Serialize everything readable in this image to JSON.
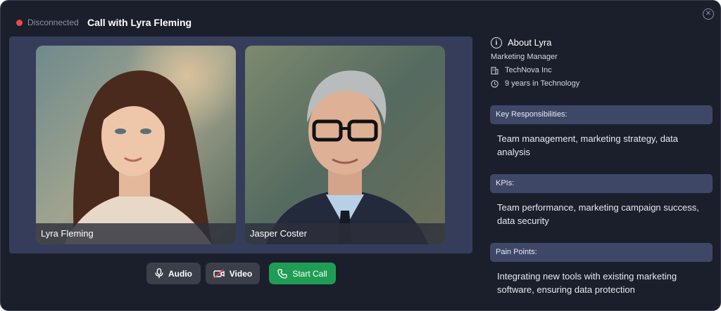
{
  "call": {
    "status": "Disconnected",
    "title": "Call with Lyra Fleming"
  },
  "colors": {
    "window_bg": "#1b1f2c",
    "stage_bg": "#363d5a",
    "status_disconnected": "#ea4a4a",
    "start_call": "#1f9d55",
    "section_header": "#3e4766"
  },
  "participants": [
    {
      "name": "Lyra Fleming",
      "icon": "participant-photo"
    },
    {
      "name": "Jasper Coster",
      "icon": "participant-photo"
    }
  ],
  "controls": {
    "audio_label": "Audio",
    "video_label": "Video",
    "start_label": "Start Call",
    "audio_icon": "microphone-icon",
    "video_icon": "video-off-icon",
    "start_icon": "phone-icon"
  },
  "about": {
    "title": "About Lyra",
    "role": "Marketing Manager",
    "company": "TechNova Inc",
    "experience": "9 years in Technology",
    "icons": {
      "info": "info-icon",
      "company": "building-icon",
      "experience": "clock-icon"
    }
  },
  "sections": [
    {
      "header": "Key Responsibilities:",
      "body": "Team management, marketing strategy, data analysis"
    },
    {
      "header": "KPIs:",
      "body": "Team performance, marketing campaign success, data security"
    },
    {
      "header": "Pain Points:",
      "body": "Integrating new tools with existing marketing software, ensuring data protection"
    }
  ]
}
